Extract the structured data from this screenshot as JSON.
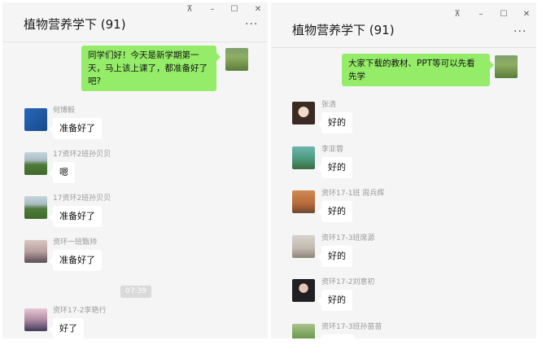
{
  "window_controls": {
    "pin": "⊼",
    "minimize": "–",
    "maximize": "☐",
    "close": "✕"
  },
  "more_glyph": "···",
  "left": {
    "title": "植物营养学下 (91)",
    "my_message": "同学们好！今天是新学期第一天，马上该上课了，都准备好了吧?",
    "messages": [
      {
        "sender": "何博毅",
        "text": "准备好了"
      },
      {
        "sender": "17资环2班孙贝贝",
        "text": "嗯"
      },
      {
        "sender": "17资环2班孙贝贝",
        "text": "准备好了"
      },
      {
        "sender": "资环一班甄帅",
        "text": "准备好了"
      },
      {
        "sender": "资环17-2李艳行",
        "text": "好了"
      }
    ],
    "time_badge": "07:39"
  },
  "right": {
    "title": "植物营养学下 (91)",
    "my_message": "大家下载的教材、PPT等可以先看先学",
    "messages": [
      {
        "sender": "张清",
        "text": "好的"
      },
      {
        "sender": "李亚蓉",
        "text": "好的"
      },
      {
        "sender": "资环17-1班 周兵辉",
        "text": "好的"
      },
      {
        "sender": "资环17-3班席源",
        "text": "好的"
      },
      {
        "sender": "资环17-2刘意初",
        "text": "好的"
      },
      {
        "sender": "资环17-3班孙苗苗",
        "text": ""
      }
    ]
  }
}
